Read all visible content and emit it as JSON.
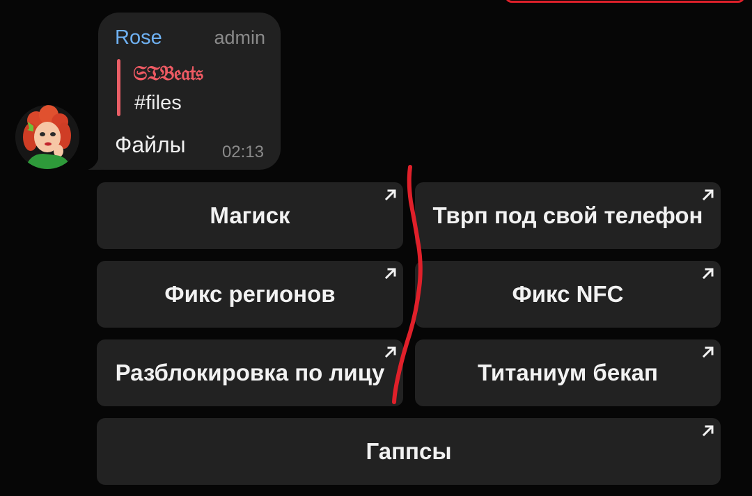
{
  "message": {
    "sender": "Rose",
    "role": "admin",
    "quote": {
      "author": "𝔖𝔗𝔅𝔢𝔞𝔱𝔰",
      "text": "#files"
    },
    "text": "Файлы",
    "time": "02:13"
  },
  "keyboard": {
    "buttons": [
      {
        "label": "Магиск"
      },
      {
        "label": "Тврп под свой телефон"
      },
      {
        "label": "Фикс регионов"
      },
      {
        "label": "Фикс NFC"
      },
      {
        "label": "Разблокировка по лицу"
      },
      {
        "label": "Титаниум бекап"
      },
      {
        "label": "Гаппсы"
      }
    ],
    "link_icon": "external-link-arrow-icon"
  },
  "annotation": {
    "color": "#e0202a"
  },
  "colors": {
    "background": "#060606",
    "bubble": "#212121",
    "sender": "#6fb1f2",
    "quote_accent": "#ea5f67",
    "button": "#222222"
  }
}
